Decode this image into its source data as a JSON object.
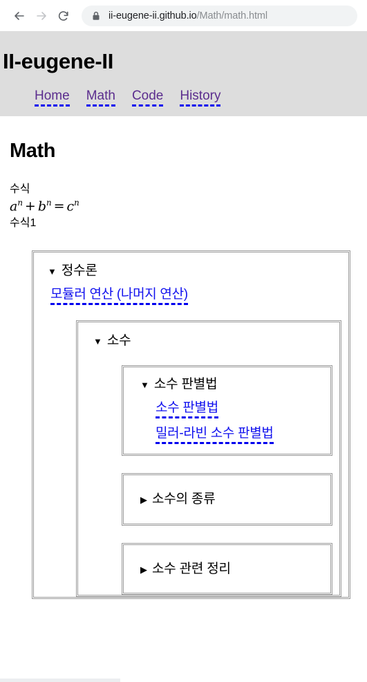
{
  "browser": {
    "back_icon": "arrow-left-icon",
    "forward_icon": "arrow-right-icon",
    "reload_icon": "reload-icon",
    "lock_icon": "lock-icon",
    "url_domain": "ii-eugene-ii.github.io",
    "url_path": "/Math/math.html"
  },
  "site": {
    "title": "II-eugene-II",
    "nav": [
      {
        "label": "Home"
      },
      {
        "label": "Math"
      },
      {
        "label": "Code"
      },
      {
        "label": "History"
      }
    ]
  },
  "page": {
    "heading": "Math",
    "formula_label": "수식",
    "formula": {
      "a": "a",
      "a_exp": "n",
      "plus": "+",
      "b": "b",
      "b_exp": "n",
      "equals": "=",
      "c": "c",
      "c_exp": "n"
    },
    "formula_label_2": "수식1"
  },
  "tree": {
    "level1": {
      "marker": "▼",
      "summary": "정수론",
      "link": "모듈러 연산 (나머지 연산)"
    },
    "level2": {
      "marker": "▼",
      "summary": "소수"
    },
    "level3": {
      "marker": "▼",
      "summary": "소수 판별법",
      "links": [
        "소수 판별법",
        "밀러-라빈 소수 판별법"
      ]
    },
    "collapsed": [
      {
        "marker": "▶",
        "summary": "소수의 종류"
      },
      {
        "marker": "▶",
        "summary": "소수 관련 정리"
      }
    ]
  },
  "colors": {
    "link": "#1010ee",
    "visited_nav_link": "#5b2d8e",
    "underline": "#0000ee",
    "header_bg": "#dddddd",
    "box_border": "#9a9a9a"
  }
}
